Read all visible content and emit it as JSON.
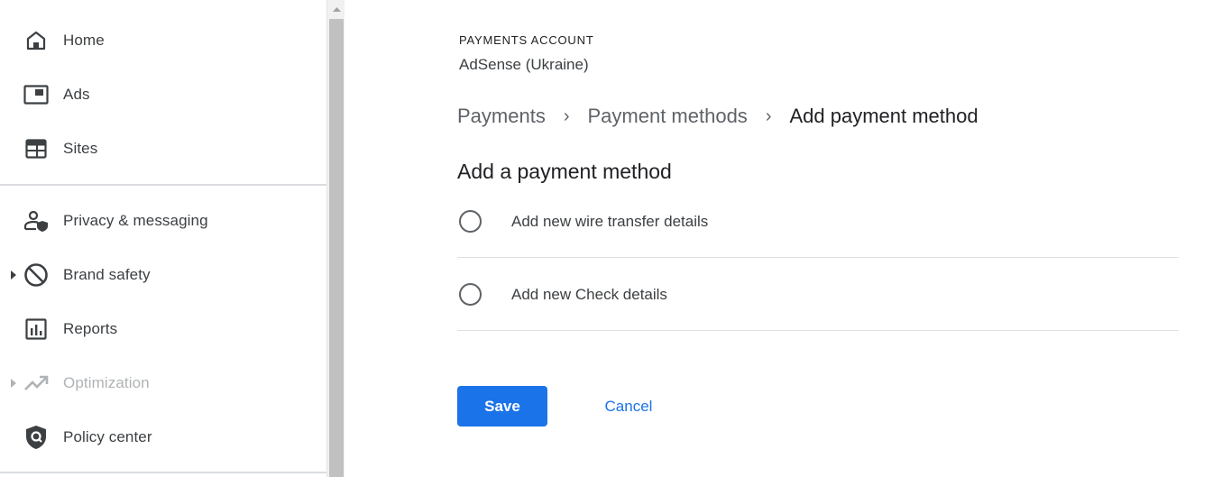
{
  "sidebar": {
    "items": [
      {
        "label": "Home",
        "icon": "home-icon"
      },
      {
        "label": "Ads",
        "icon": "ads-icon"
      },
      {
        "label": "Sites",
        "icon": "sites-icon"
      },
      {
        "label": "Privacy & messaging",
        "icon": "privacy-icon"
      },
      {
        "label": "Brand safety",
        "icon": "block-icon",
        "expandable": true
      },
      {
        "label": "Reports",
        "icon": "bar-chart-icon"
      },
      {
        "label": "Optimization",
        "icon": "trending-up-icon",
        "expandable": true,
        "disabled": true
      },
      {
        "label": "Policy center",
        "icon": "policy-shield-icon"
      }
    ]
  },
  "account": {
    "label": "PAYMENTS ACCOUNT",
    "name": "AdSense (Ukraine)"
  },
  "breadcrumb": {
    "items": [
      "Payments",
      "Payment methods",
      "Add payment method"
    ],
    "separator": "›"
  },
  "form": {
    "title": "Add a payment method",
    "options": [
      {
        "label": "Add new wire transfer details",
        "selected": false
      },
      {
        "label": "Add new Check details",
        "selected": false
      }
    ],
    "save_label": "Save",
    "cancel_label": "Cancel"
  },
  "colors": {
    "accent": "#1a73e8",
    "text": "#3c4043",
    "disabled": "#b0b3b6"
  }
}
